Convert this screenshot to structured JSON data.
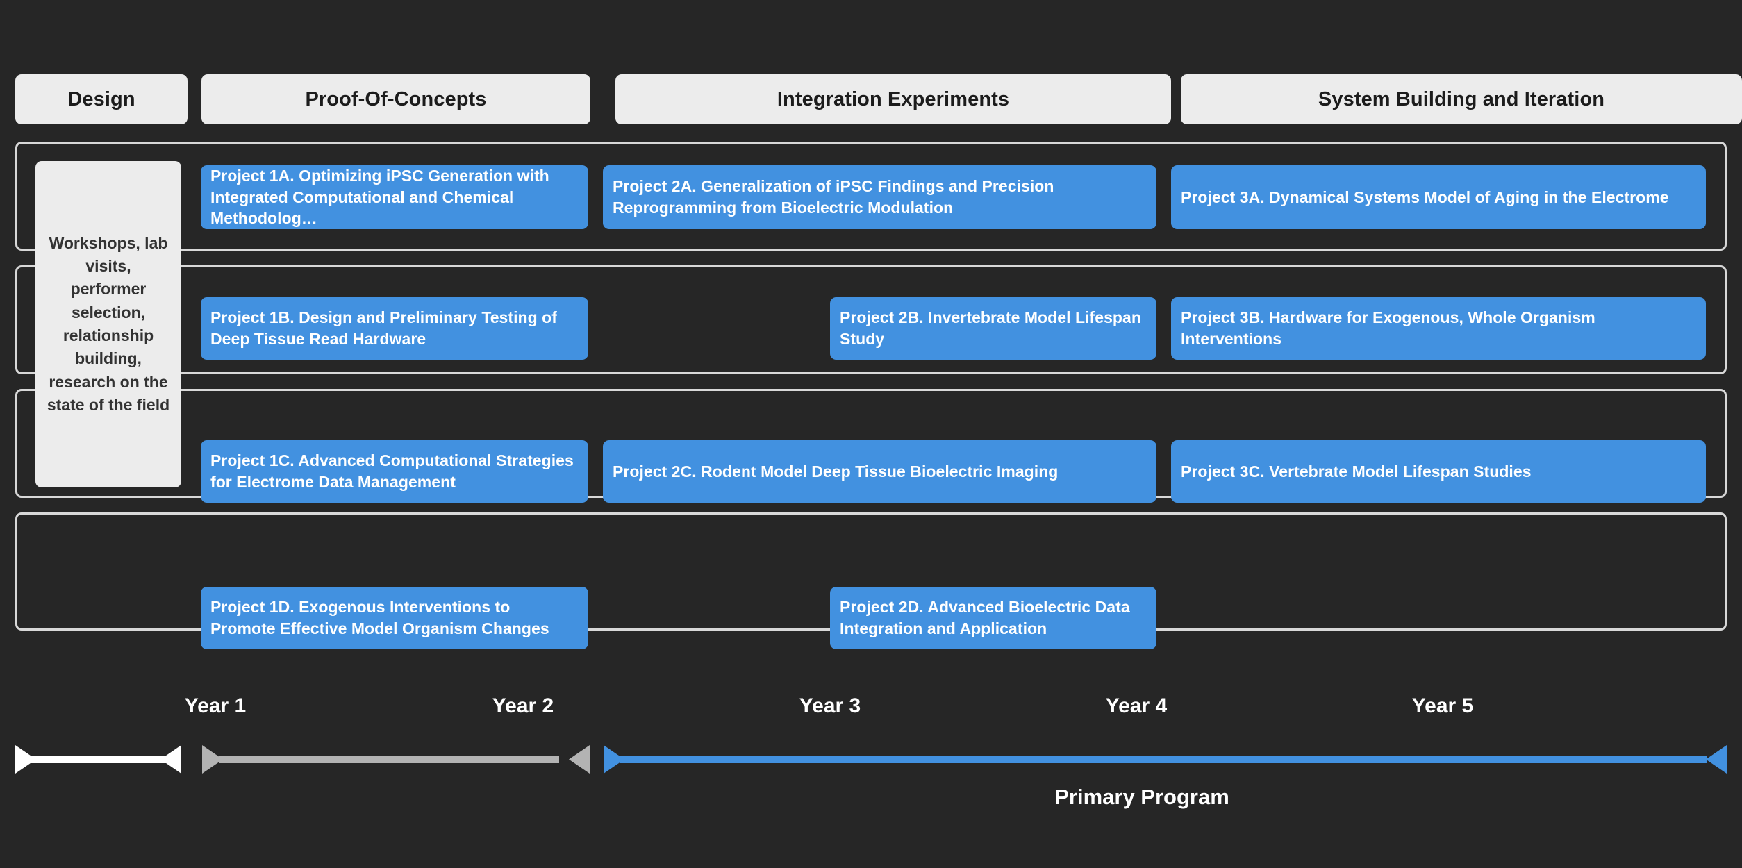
{
  "background_color": "#262626",
  "accent_color": "#4291e0",
  "panel_color": "#ececec",
  "lane_border_color": "#d8d8d8",
  "phases": [
    {
      "id": "design",
      "label": "Design"
    },
    {
      "id": "proof-of-concepts",
      "label": "Proof-Of-Concepts"
    },
    {
      "id": "integration",
      "label": "Integration Experiments"
    },
    {
      "id": "system-building",
      "label": "System Building and Iteration"
    }
  ],
  "design_panel": {
    "text": "Workshops, lab visits, performer selection, relationship building, research on the state of the field"
  },
  "lanes": [
    {
      "id": "lane-a",
      "cards": [
        "1A",
        "2A",
        "3A"
      ]
    },
    {
      "id": "lane-b",
      "cards": [
        "1B",
        "2B",
        "3B"
      ]
    },
    {
      "id": "lane-c",
      "cards": [
        "1C",
        "2C",
        "3C"
      ]
    },
    {
      "id": "lane-d",
      "cards": [
        "1D",
        "2D"
      ]
    }
  ],
  "cards": {
    "1A": {
      "title": "Project 1A. Optimizing iPSC Generation with Integrated Computational and Chemical Methodolog…"
    },
    "2A": {
      "title": "Project 2A. Generalization of iPSC Findings and Precision Reprogramming from Bioelectric Modulation"
    },
    "3A": {
      "title": "Project 3A. Dynamical Systems Model of Aging in the Electrome"
    },
    "1B": {
      "title": "Project 1B. Design and Preliminary Testing of Deep Tissue Read Hardware"
    },
    "2B": {
      "title": "Project 2B. Invertebrate Model Lifespan Study"
    },
    "3B": {
      "title": "Project 3B. Hardware for Exogenous, Whole Organism Interventions"
    },
    "1C": {
      "title": "Project 1C. Advanced Computational Strategies for Electrome Data Management"
    },
    "2C": {
      "title": "Project 2C. Rodent Model Deep Tissue Bioelectric Imaging"
    },
    "3C": {
      "title": "Project 3C. Vertebrate Model Lifespan Studies"
    },
    "1D": {
      "title": "Project 1D. Exogenous Interventions to Promote Effective Model Organism Changes"
    },
    "2D": {
      "title": "Project 2D. Advanced Bioelectric Data Integration and Application"
    }
  },
  "timeline": {
    "years": [
      {
        "label": "Year 1"
      },
      {
        "label": "Year 2"
      },
      {
        "label": "Year 3"
      },
      {
        "label": "Year 4"
      },
      {
        "label": "Year 5"
      }
    ],
    "segments": [
      {
        "id": "design-arrow",
        "color": "#ffffff",
        "heads": "both"
      },
      {
        "id": "prep-arrow",
        "color": "#b3b3b3",
        "heads": "both"
      },
      {
        "id": "primary-arrow",
        "color": "#4291e0",
        "heads": "both"
      }
    ],
    "caption": "Primary Program"
  }
}
